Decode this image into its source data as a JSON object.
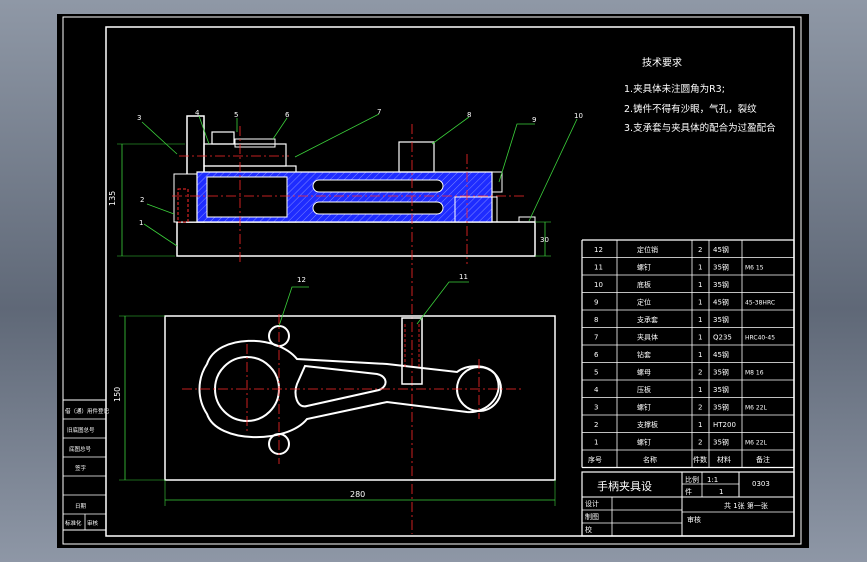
{
  "requirements": {
    "title": "技术要求",
    "items": [
      "1.夹具体未注圆角为R3;",
      "2.铸件不得有沙眼，气孔，裂纹",
      "3.支承套与夹具体的配合为过盈配合"
    ]
  },
  "callouts": [
    "1",
    "2",
    "3",
    "4",
    "5",
    "6",
    "7",
    "8",
    "9",
    "10",
    "11",
    "12"
  ],
  "dimensions": {
    "front_height": "135",
    "base_height": "30",
    "plan_depth": "150",
    "plan_length": "280"
  },
  "bom_rows": [
    {
      "no": "12",
      "name": "定位销",
      "qty": "2",
      "material": "45钢",
      "note": ""
    },
    {
      "no": "11",
      "name": "螺钉",
      "qty": "1",
      "material": "35钢",
      "note": "M6 15"
    },
    {
      "no": "10",
      "name": "底板",
      "qty": "1",
      "material": "35钢",
      "note": ""
    },
    {
      "no": "9",
      "name": "定位",
      "qty": "1",
      "material": "45钢",
      "note": "45-38HRC"
    },
    {
      "no": "8",
      "name": "支承套",
      "qty": "1",
      "material": "35钢",
      "note": ""
    },
    {
      "no": "7",
      "name": "夹具体",
      "qty": "1",
      "material": "Q235",
      "note": "HRC40-45"
    },
    {
      "no": "6",
      "name": "钻套",
      "qty": "1",
      "material": "45钢",
      "note": ""
    },
    {
      "no": "5",
      "name": "螺母",
      "qty": "2",
      "material": "35钢",
      "note": "M8 16"
    },
    {
      "no": "4",
      "name": "压板",
      "qty": "1",
      "material": "35钢",
      "note": ""
    },
    {
      "no": "3",
      "name": "螺钉",
      "qty": "2",
      "material": "35钢",
      "note": "M6 22L"
    },
    {
      "no": "2",
      "name": "支撑板",
      "qty": "1",
      "material": "HT200",
      "note": ""
    },
    {
      "no": "1",
      "name": "螺钉",
      "qty": "2",
      "material": "35钢",
      "note": "M6 22L"
    }
  ],
  "bom_header": {
    "no": "序号",
    "name": "名称",
    "qty": "件数",
    "material": "材料",
    "note": "备注"
  },
  "title_block": {
    "title": "手柄夹具设",
    "scale_label": "比例",
    "scale_value": "1:1",
    "count_label": "件",
    "count_value": "1",
    "drawing_no": "0303",
    "sheets": "共 1张 第一张",
    "design_label": "设计",
    "check_label": "校",
    "review_label": "审核",
    "draw_label": "制图"
  },
  "side_stamp": [
    "借（通）用件登记",
    "旧底图总号",
    "底图总号",
    "签字",
    "日期",
    "标准化",
    "审核"
  ],
  "colors": {
    "frame": "#ffffff",
    "part_hatch": "#1e2cff",
    "centerline": "#ff2a2a",
    "leader": "#3bd13b",
    "dimension": "#3bd13b",
    "background": "#000000"
  }
}
